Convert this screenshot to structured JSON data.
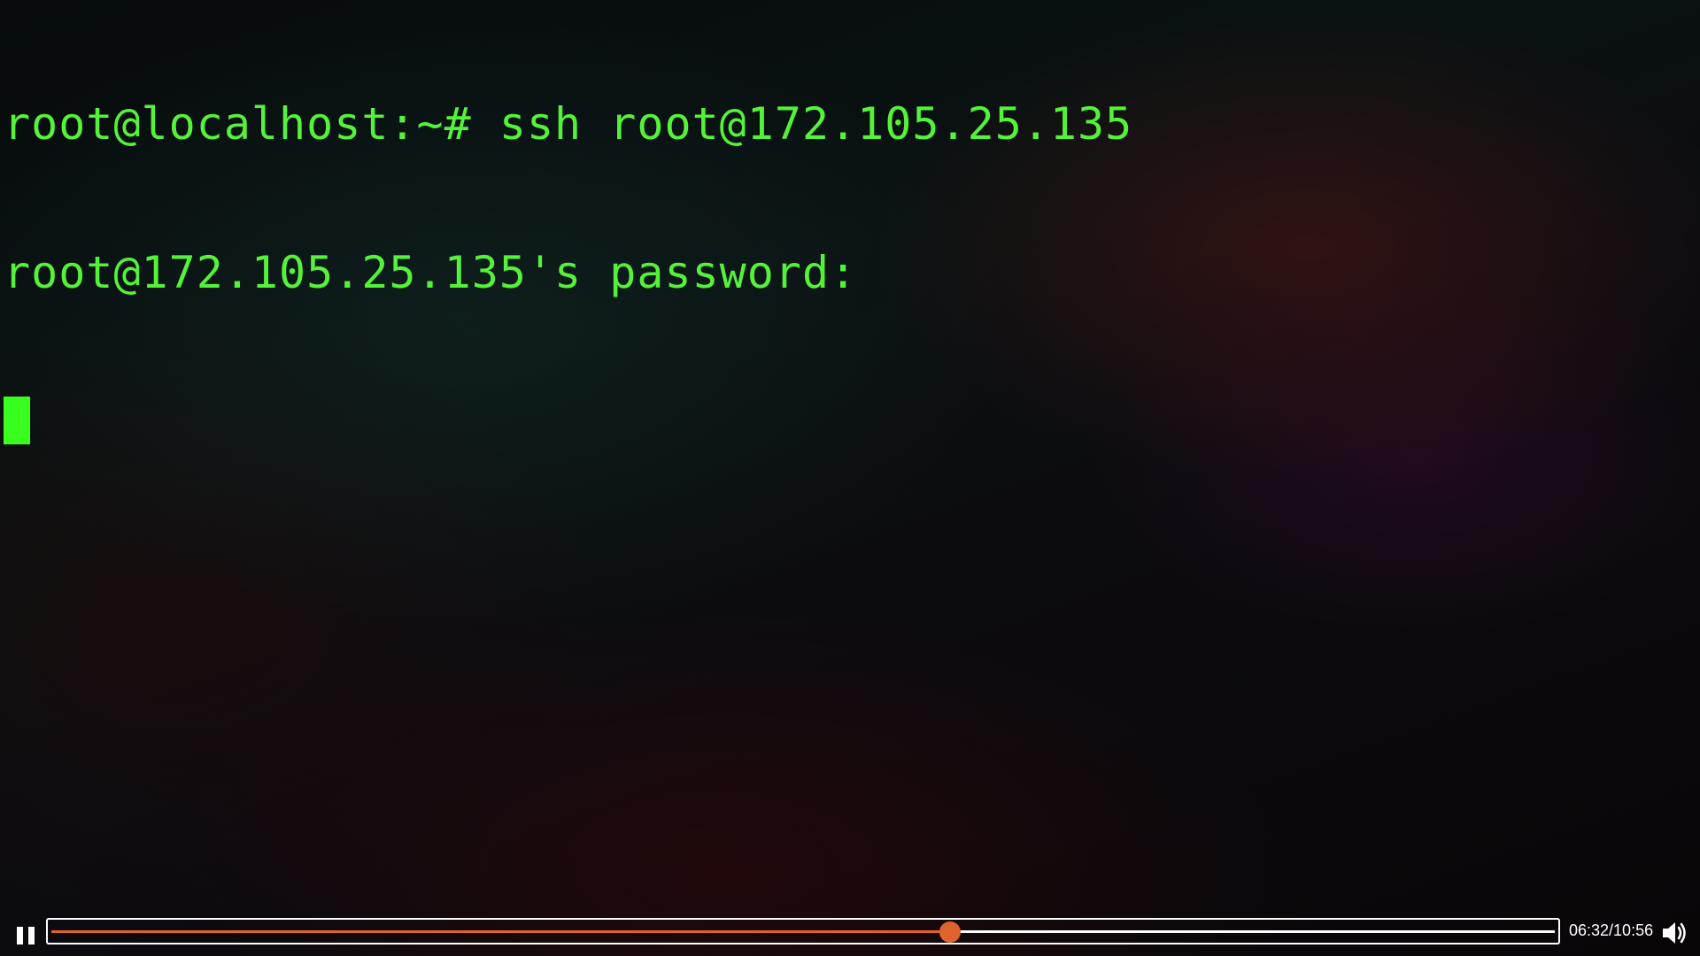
{
  "terminal": {
    "lines": [
      "root@localhost:~# ssh root@172.105.25.135",
      "root@172.105.25.135's password:"
    ],
    "text_color": "#55f23a",
    "cursor_color": "#39ff1e"
  },
  "player": {
    "state_icon": "pause-icon",
    "current_time": "06:32",
    "duration": "10:56",
    "time_display": "06:32/10:56",
    "progress_fraction": 0.5976,
    "accent_color": "#e0622d",
    "volume_icon": "speaker-icon"
  }
}
